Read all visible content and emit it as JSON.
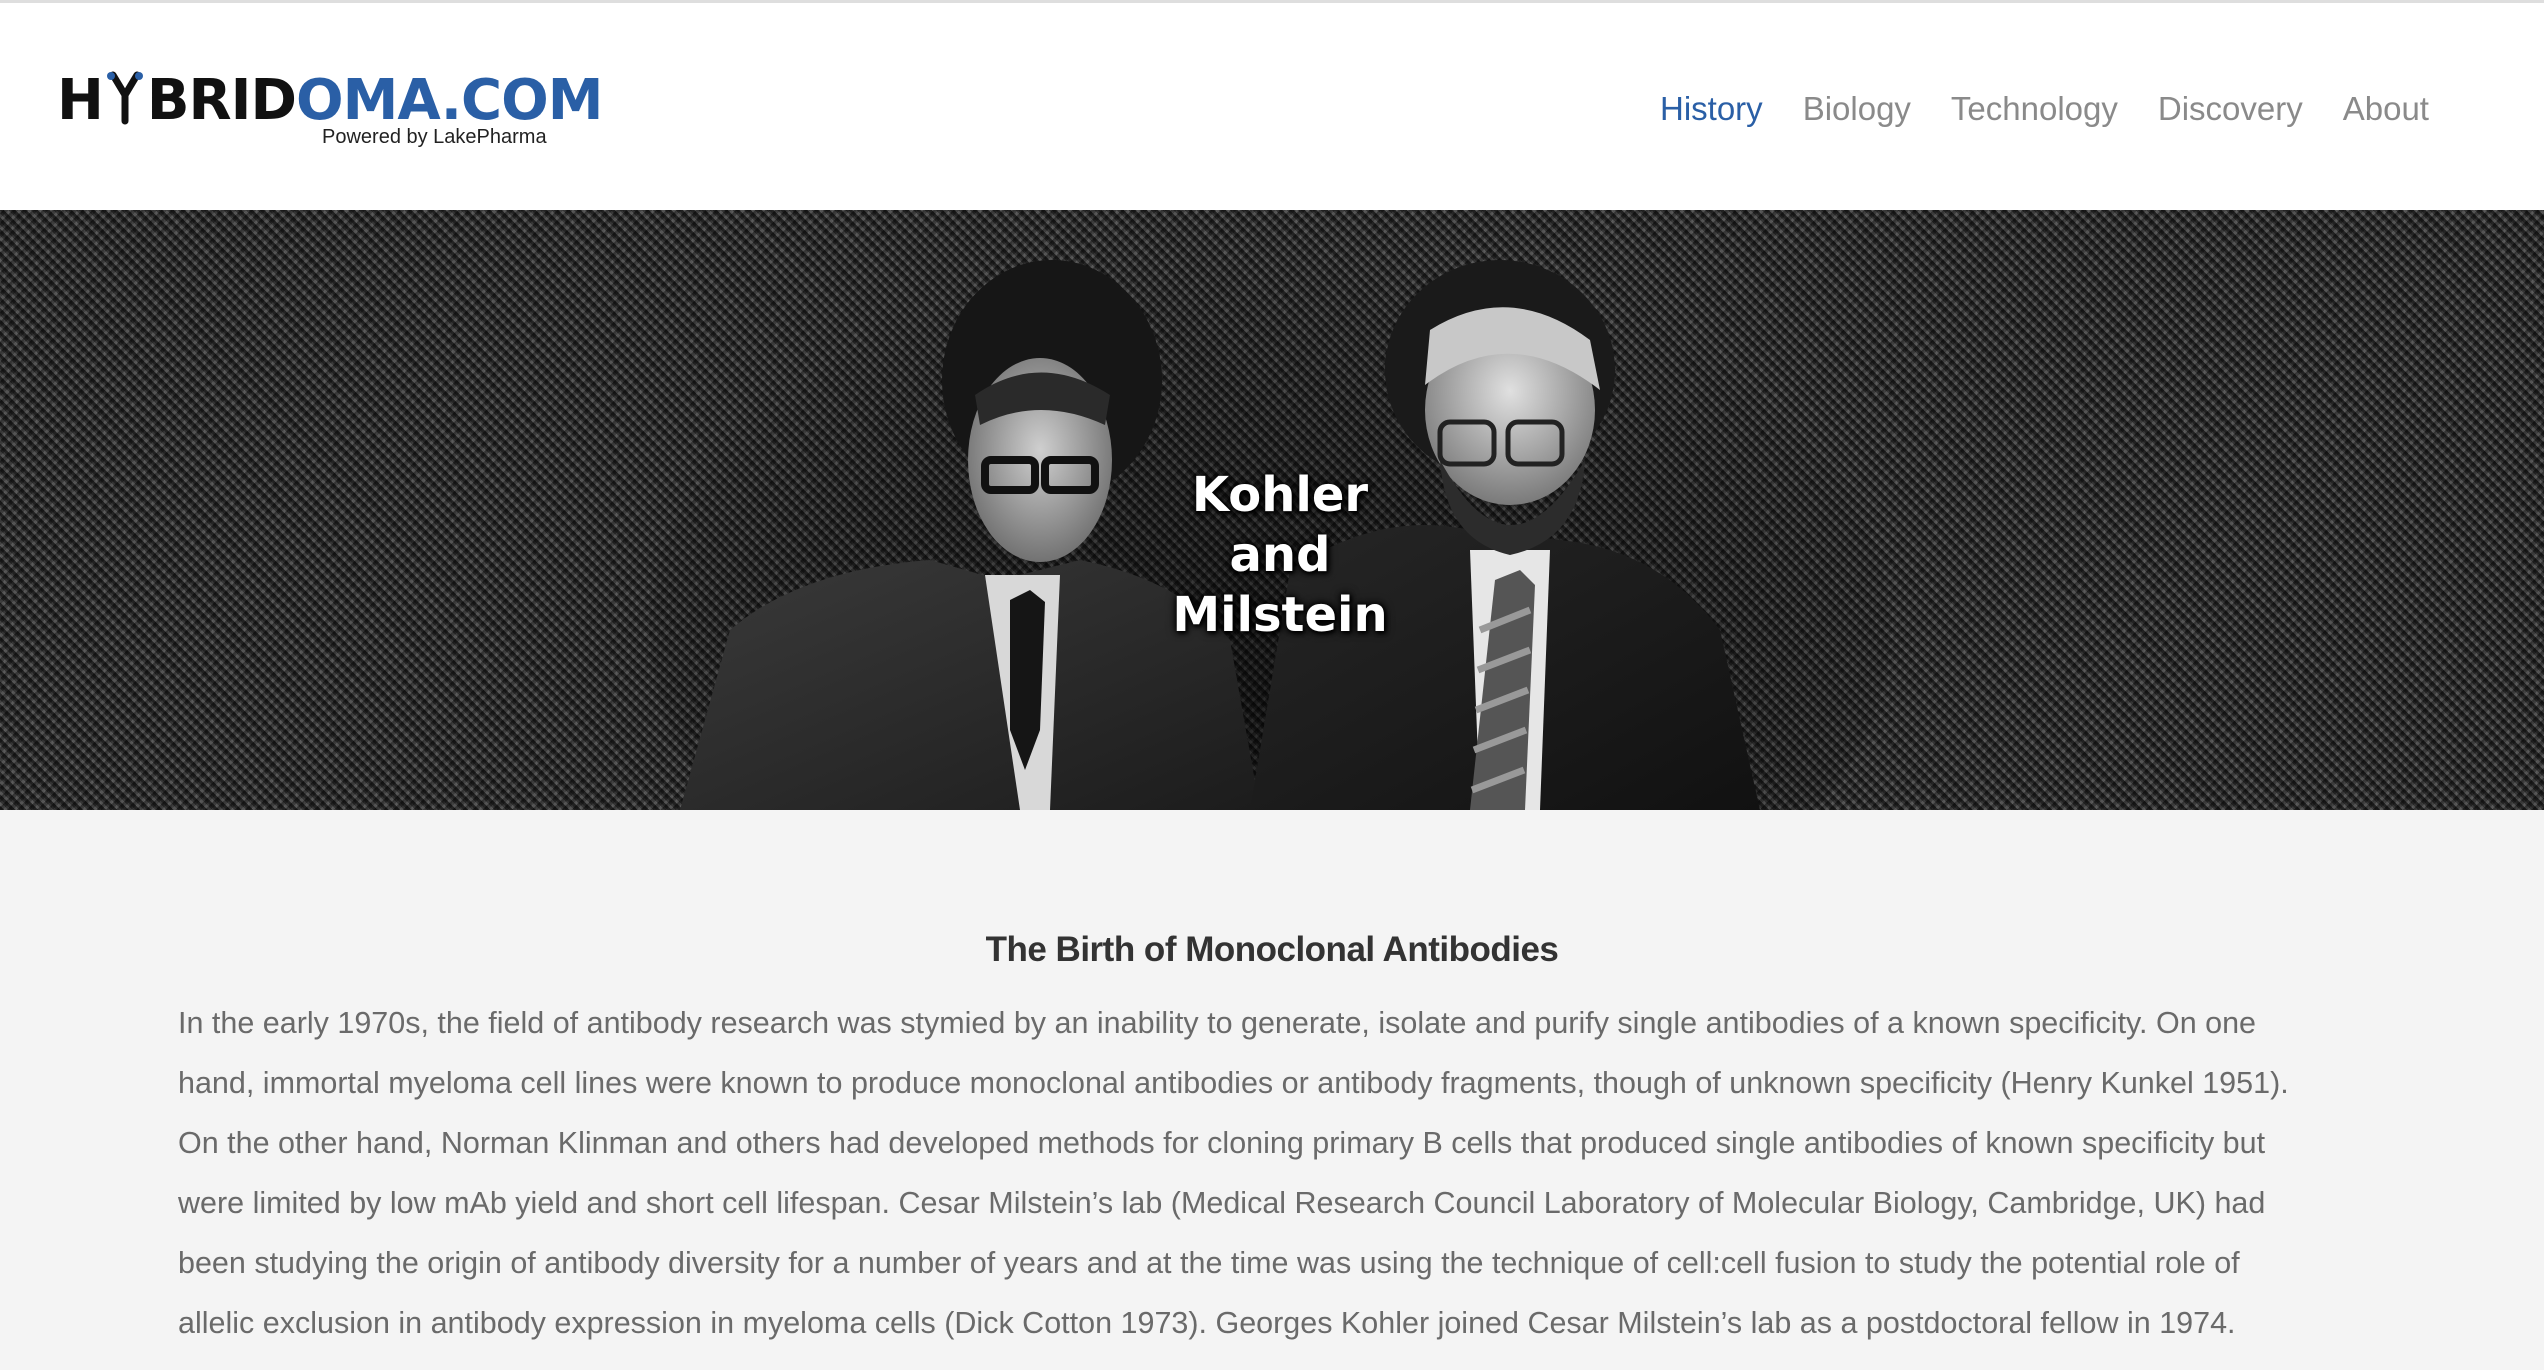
{
  "site": {
    "logo_part1": "H",
    "logo_part2": "BRID",
    "logo_part3": "OMA.COM",
    "logo_tagline": "Powered by LakePharma",
    "brand_color": "#2a5fa6"
  },
  "nav": {
    "items": [
      {
        "label": "History",
        "active": true
      },
      {
        "label": "Biology",
        "active": false
      },
      {
        "label": "Technology",
        "active": false
      },
      {
        "label": "Discovery",
        "active": false
      },
      {
        "label": "About",
        "active": false
      }
    ]
  },
  "hero": {
    "caption_line1": "Kohler",
    "caption_line2": "and",
    "caption_line3": "Milstein"
  },
  "article": {
    "title": "The Birth of Monoclonal Antibodies",
    "lines": [
      "In the early 1970s, the field of antibody research was stymied by an inability to generate, isolate and purify single antibodies of a known specificity. On one",
      "hand, immortal myeloma cell lines were known to produce monoclonal antibodies or antibody fragments, though of unknown specificity (Henry Kunkel 1951).",
      "On the other hand, Norman Klinman and others had developed methods for cloning primary B cells that produced single antibodies of known specificity but",
      "were limited by low mAb yield and short cell lifespan. Cesar Milstein’s lab (Medical Research Council Laboratory of Molecular Biology, Cambridge, UK) had",
      "been studying the origin of antibody diversity for a number of years and at the time was using the technique of cell:cell fusion to study the potential role of",
      "allelic exclusion in antibody expression in myeloma cells (Dick Cotton 1973). Georges Kohler joined Cesar Milstein’s lab as a postdoctoral fellow in 1974."
    ]
  }
}
